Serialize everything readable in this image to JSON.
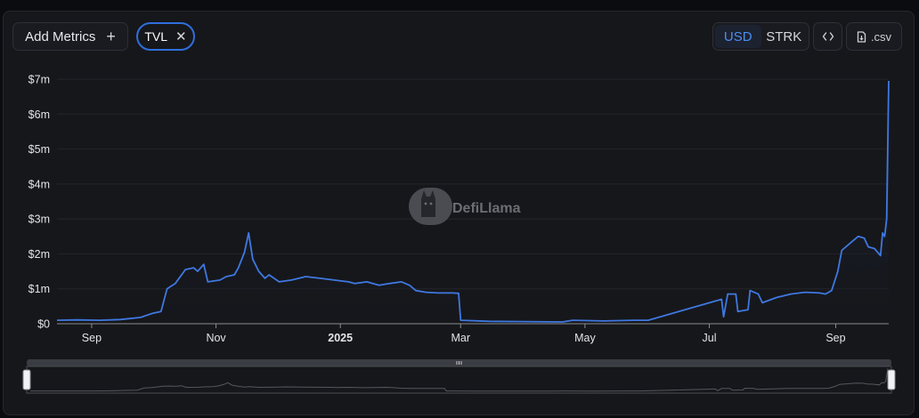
{
  "toolbar": {
    "add_metrics_label": "Add Metrics",
    "add_icon": "plus-icon",
    "metric_chip_label": "TVL",
    "remove_icon": "close-icon",
    "currency_options": [
      "USD",
      "STRK"
    ],
    "currency_selected": "USD",
    "embed_icon": "code-icon",
    "csv_label": ".csv",
    "csv_icon": "file-download-icon"
  },
  "watermark": {
    "text": "DefiLlama",
    "icon": "llama-logo-icon"
  },
  "colors": {
    "line": "#3f78e0",
    "area_top": "#1c2a4a",
    "active": "#4d8ef0"
  },
  "chart_data": {
    "type": "area",
    "title": "",
    "xlabel": "",
    "ylabel": "",
    "y_ticks": [
      0,
      1,
      2,
      3,
      4,
      5,
      6,
      7
    ],
    "y_tick_labels": [
      "$0",
      "$1m",
      "$2m",
      "$3m",
      "$4m",
      "$5m",
      "$6m",
      "$7m"
    ],
    "ylim": [
      0,
      7
    ],
    "y_unit": "million USD",
    "xlim": [
      "2024-08-15",
      "2025-09-27"
    ],
    "x_ticks": [
      "2024-09-01",
      "2024-11-01",
      "2025-01-01",
      "2025-03-01",
      "2025-05-01",
      "2025-07-01",
      "2025-09-01"
    ],
    "x_tick_labels": [
      "Sep",
      "Nov",
      "2025",
      "Mar",
      "May",
      "Jul",
      "Sep"
    ],
    "x_tick_bold": [
      false,
      false,
      true,
      false,
      false,
      false,
      false
    ],
    "grid": true,
    "series": [
      {
        "name": "TVL",
        "points": [
          [
            "2024-08-15",
            0.1
          ],
          [
            "2024-08-25",
            0.11
          ],
          [
            "2024-09-05",
            0.1
          ],
          [
            "2024-09-15",
            0.12
          ],
          [
            "2024-09-25",
            0.18
          ],
          [
            "2024-10-01",
            0.3
          ],
          [
            "2024-10-05",
            0.35
          ],
          [
            "2024-10-08",
            1.0
          ],
          [
            "2024-10-12",
            1.15
          ],
          [
            "2024-10-17",
            1.55
          ],
          [
            "2024-10-21",
            1.6
          ],
          [
            "2024-10-23",
            1.5
          ],
          [
            "2024-10-26",
            1.7
          ],
          [
            "2024-10-28",
            1.2
          ],
          [
            "2024-11-03",
            1.25
          ],
          [
            "2024-11-06",
            1.35
          ],
          [
            "2024-11-10",
            1.4
          ],
          [
            "2024-11-12",
            1.6
          ],
          [
            "2024-11-15",
            2.05
          ],
          [
            "2024-11-17",
            2.6
          ],
          [
            "2024-11-19",
            1.85
          ],
          [
            "2024-11-22",
            1.5
          ],
          [
            "2024-11-25",
            1.3
          ],
          [
            "2024-11-27",
            1.4
          ],
          [
            "2024-12-02",
            1.2
          ],
          [
            "2024-12-08",
            1.25
          ],
          [
            "2024-12-15",
            1.35
          ],
          [
            "2024-12-22",
            1.3
          ],
          [
            "2024-12-29",
            1.25
          ],
          [
            "2025-01-05",
            1.2
          ],
          [
            "2025-01-08",
            1.15
          ],
          [
            "2025-01-14",
            1.2
          ],
          [
            "2025-01-20",
            1.1
          ],
          [
            "2025-01-25",
            1.15
          ],
          [
            "2025-01-31",
            1.2
          ],
          [
            "2025-02-04",
            1.1
          ],
          [
            "2025-02-07",
            0.95
          ],
          [
            "2025-02-12",
            0.9
          ],
          [
            "2025-02-18",
            0.88
          ],
          [
            "2025-02-25",
            0.88
          ],
          [
            "2025-02-28",
            0.87
          ],
          [
            "2025-03-01",
            0.1
          ],
          [
            "2025-03-15",
            0.07
          ],
          [
            "2025-04-01",
            0.06
          ],
          [
            "2025-04-20",
            0.05
          ],
          [
            "2025-04-25",
            0.1
          ],
          [
            "2025-05-10",
            0.08
          ],
          [
            "2025-05-25",
            0.1
          ],
          [
            "2025-06-01",
            0.1
          ],
          [
            "2025-07-07",
            0.7
          ],
          [
            "2025-07-08",
            0.2
          ],
          [
            "2025-07-10",
            0.85
          ],
          [
            "2025-07-14",
            0.85
          ],
          [
            "2025-07-15",
            0.35
          ],
          [
            "2025-07-20",
            0.4
          ],
          [
            "2025-07-21",
            0.95
          ],
          [
            "2025-07-25",
            0.85
          ],
          [
            "2025-07-27",
            0.6
          ],
          [
            "2025-08-03",
            0.75
          ],
          [
            "2025-08-10",
            0.85
          ],
          [
            "2025-08-17",
            0.9
          ],
          [
            "2025-08-24",
            0.88
          ],
          [
            "2025-08-27",
            0.85
          ],
          [
            "2025-08-30",
            0.95
          ],
          [
            "2025-09-02",
            1.5
          ],
          [
            "2025-09-04",
            2.1
          ],
          [
            "2025-09-08",
            2.3
          ],
          [
            "2025-09-12",
            2.5
          ],
          [
            "2025-09-15",
            2.45
          ],
          [
            "2025-09-17",
            2.2
          ],
          [
            "2025-09-20",
            2.15
          ],
          [
            "2025-09-23",
            1.95
          ],
          [
            "2025-09-24",
            2.6
          ],
          [
            "2025-09-25",
            2.5
          ],
          [
            "2025-09-26",
            3.0
          ],
          [
            "2025-09-27",
            6.95
          ]
        ]
      }
    ]
  }
}
